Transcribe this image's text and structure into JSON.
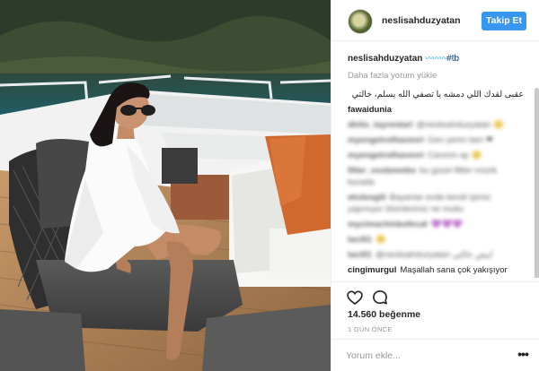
{
  "header": {
    "username": "neslisahduzyatan",
    "follow_label": "Takip Et"
  },
  "caption": {
    "username": "neslisahduzyatan",
    "emoji": "〰〰〰",
    "hashtag": "#tb"
  },
  "load_more": "Daha fazla yorum yükle",
  "comments": [
    {
      "user": "",
      "text": "عقبى لقدك اللي دمشه يا تصفي الله يسلم، خالتي",
      "blurred": false,
      "arabic": true
    },
    {
      "user": "fawaidunia",
      "text": "",
      "blurred": false,
      "arabic": false
    },
    {
      "user": "dtrlio_tayrentarl",
      "text": "@neslisahduzyatan 😊",
      "blurred": true,
      "arabic": false
    },
    {
      "user": "myengetrolhavenri",
      "text": "Gen yerim ben ❤",
      "blurred": true,
      "arabic": false
    },
    {
      "user": "myengetrolhavenri",
      "text": "Canmm ay 😊",
      "blurred": true,
      "arabic": false
    },
    {
      "user": "filter_vosbmmbs",
      "text": "bu güzel filtler müzik burada",
      "blurred": true,
      "arabic": false
    },
    {
      "user": "ekslesgili",
      "text": "Bayanlar evde kendi işimiz yapmıyor ölümlerimiz ne mutlu",
      "blurred": true,
      "arabic": false
    },
    {
      "user": "mycimachinbofecaf",
      "text": "💜💜💜",
      "blurred": true,
      "arabic": false
    },
    {
      "user": "tacill1",
      "text": "😊",
      "blurred": true,
      "arabic": false
    },
    {
      "user": "tacill1",
      "text": "@neslisahduzyatan ابيض خالتي",
      "blurred": true,
      "arabic": false
    },
    {
      "user": "cingimurgul",
      "text": "Maşallah sana çok yakışıyor",
      "blurred": false,
      "arabic": false
    }
  ],
  "likes": "14.560 beğenme",
  "timestamp": "1 GÜN ÖNCE",
  "comment_input": {
    "placeholder": "Yorum ekle..."
  },
  "icons": {
    "like": "heart-outline-icon",
    "comment": "speech-bubble-icon",
    "more": "more-options-icon"
  },
  "colors": {
    "follow_button": "#3897f0",
    "hashtag": "#003569",
    "muted": "#999999"
  }
}
